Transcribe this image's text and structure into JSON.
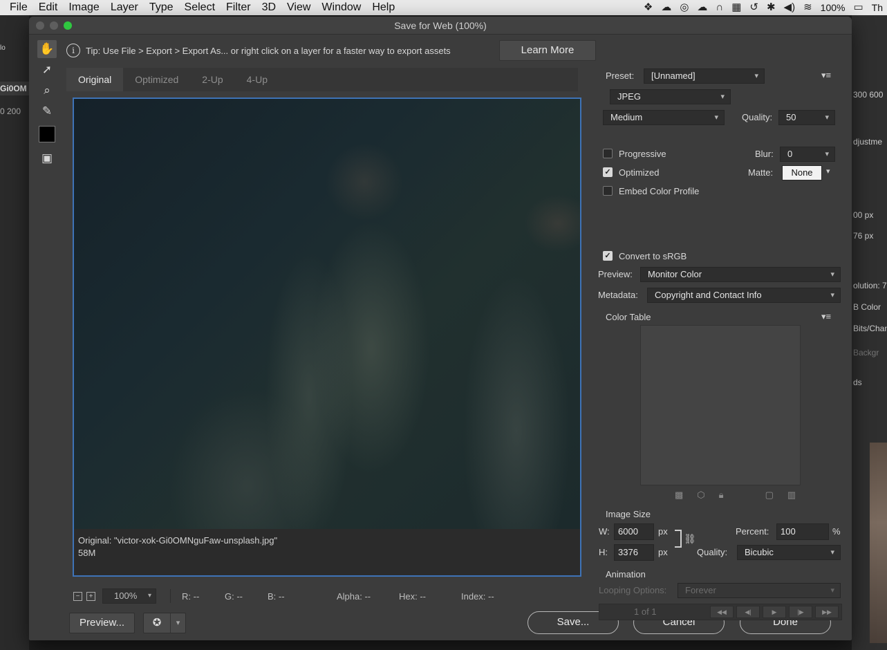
{
  "menubar": {
    "items": [
      "File",
      "Edit",
      "Image",
      "Layer",
      "Type",
      "Select",
      "Filter",
      "3D",
      "View",
      "Window",
      "Help"
    ],
    "battery": "100%",
    "clock": "Th"
  },
  "background": {
    "left_label_1": "lo",
    "left_tab": "Gi0OM",
    "left_ruler": "0  200",
    "right_labels": [
      "300 600",
      "djustme",
      "00 px",
      "76 px",
      "olution: 7",
      "B Color",
      "Bits/Chan",
      "Backgr",
      "ds"
    ]
  },
  "dialog": {
    "title": "Save for Web (100%)",
    "tip": "Tip: Use File > Export > Export As...  or right click on a layer for a faster way to export assets",
    "learn_more": "Learn More",
    "tabs": [
      "Original",
      "Optimized",
      "2-Up",
      "4-Up"
    ],
    "active_tab": "Original",
    "caption_line1": "Original: \"victor-xok-Gi0OMNguFaw-unsplash.jpg\"",
    "caption_line2": "58M",
    "status": {
      "zoom": "100%",
      "r": "R: --",
      "g": "G: --",
      "b": "B: --",
      "alpha": "Alpha: --",
      "hex": "Hex: --",
      "index": "Index: --"
    },
    "buttons": {
      "preview": "Preview...",
      "save": "Save...",
      "cancel": "Cancel",
      "done": "Done"
    }
  },
  "settings": {
    "preset_label": "Preset:",
    "preset_value": "[Unnamed]",
    "format": "JPEG",
    "quality_preset": "Medium",
    "quality_label": "Quality:",
    "quality_value": "50",
    "blur_label": "Blur:",
    "blur_value": "0",
    "matte_label": "Matte:",
    "matte_value": "None",
    "progressive": {
      "label": "Progressive",
      "checked": false
    },
    "optimized": {
      "label": "Optimized",
      "checked": true
    },
    "embed_profile": {
      "label": "Embed Color Profile",
      "checked": false
    },
    "convert_srgb": {
      "label": "Convert to sRGB",
      "checked": true
    },
    "preview_label": "Preview:",
    "preview_value": "Monitor Color",
    "metadata_label": "Metadata:",
    "metadata_value": "Copyright and Contact Info",
    "color_table_label": "Color Table",
    "image_size_label": "Image Size",
    "w_label": "W:",
    "w_value": "6000",
    "h_label": "H:",
    "h_value": "3376",
    "px": "px",
    "percent_label": "Percent:",
    "percent_value": "100",
    "percent_unit": "%",
    "resample_label": "Quality:",
    "resample_value": "Bicubic",
    "animation_label": "Animation",
    "looping_label": "Looping Options:",
    "looping_value": "Forever",
    "frame_counter": "1 of 1"
  }
}
